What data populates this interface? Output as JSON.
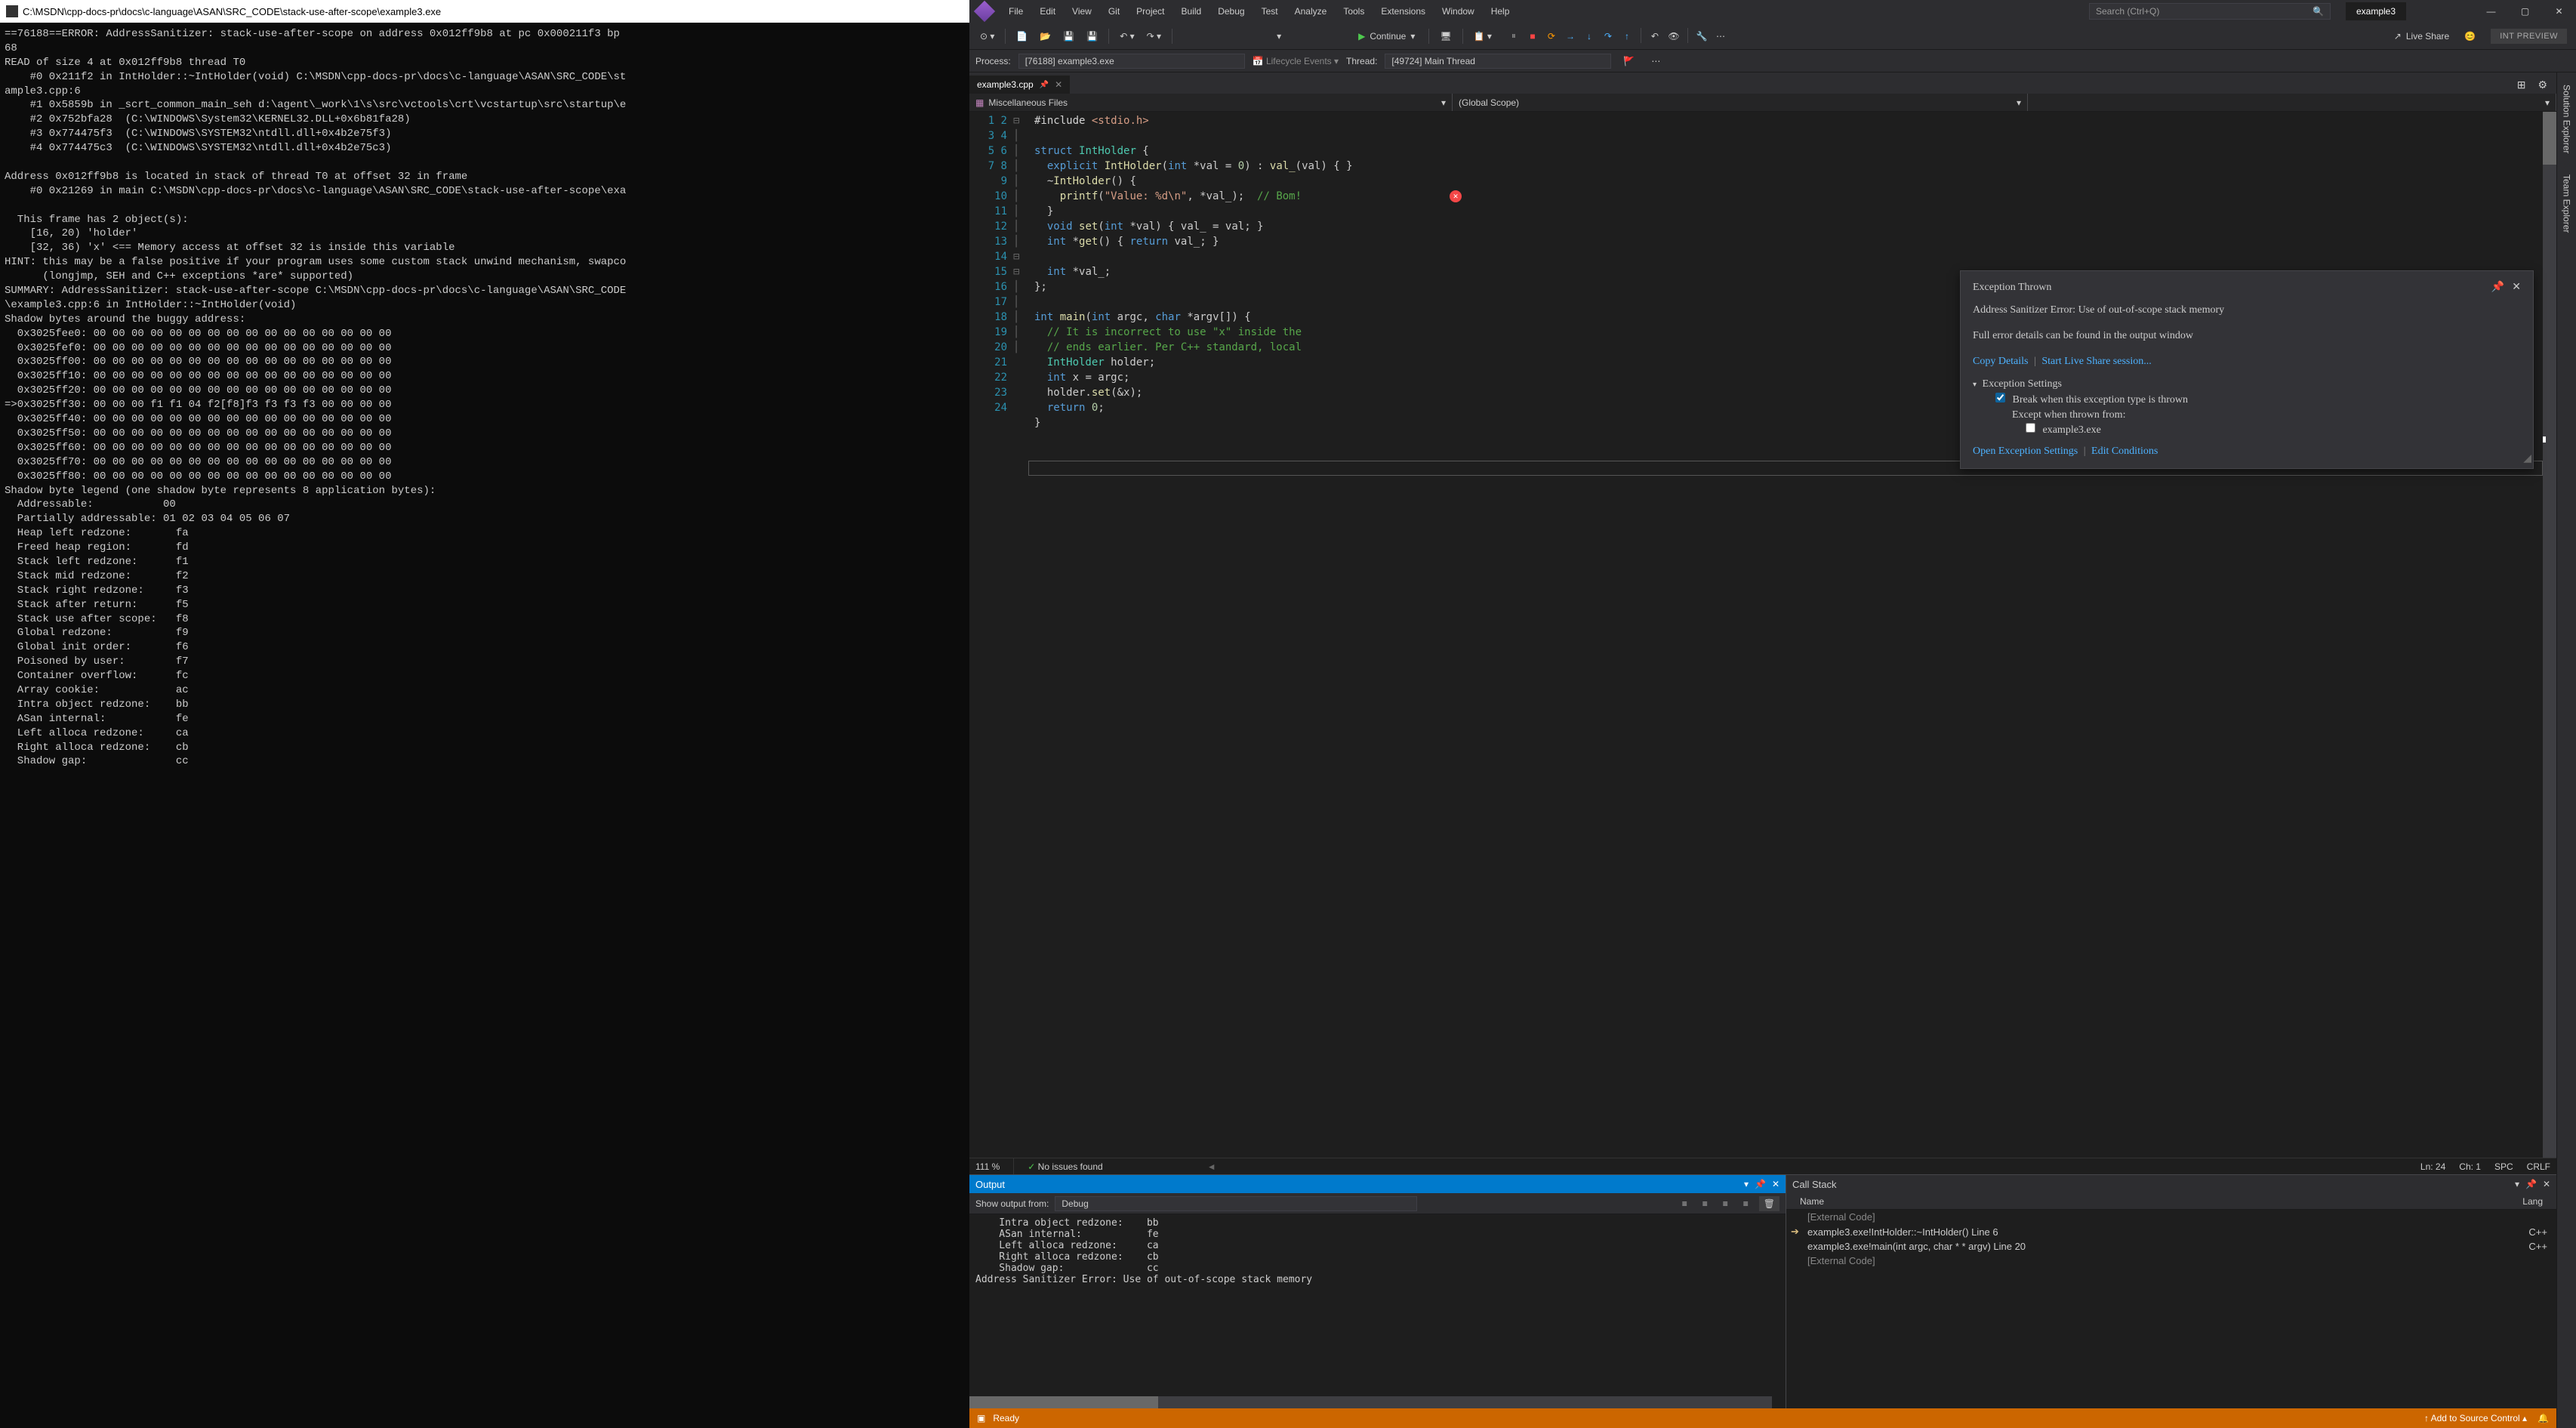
{
  "console": {
    "title_path": "C:\\MSDN\\cpp-docs-pr\\docs\\c-language\\ASAN\\SRC_CODE\\stack-use-after-scope\\example3.exe",
    "text": "==76188==ERROR: AddressSanitizer: stack-use-after-scope on address 0x012ff9b8 at pc 0x000211f3 bp\n68\nREAD of size 4 at 0x012ff9b8 thread T0\n    #0 0x211f2 in IntHolder::~IntHolder(void) C:\\MSDN\\cpp-docs-pr\\docs\\c-language\\ASAN\\SRC_CODE\\st\nample3.cpp:6\n    #1 0x5859b in _scrt_common_main_seh d:\\agent\\_work\\1\\s\\src\\vctools\\crt\\vcstartup\\src\\startup\\e\n    #2 0x752bfa28  (C:\\WINDOWS\\System32\\KERNEL32.DLL+0x6b81fa28)\n    #3 0x774475f3  (C:\\WINDOWS\\SYSTEM32\\ntdll.dll+0x4b2e75f3)\n    #4 0x774475c3  (C:\\WINDOWS\\SYSTEM32\\ntdll.dll+0x4b2e75c3)\n\nAddress 0x012ff9b8 is located in stack of thread T0 at offset 32 in frame\n    #0 0x21269 in main C:\\MSDN\\cpp-docs-pr\\docs\\c-language\\ASAN\\SRC_CODE\\stack-use-after-scope\\exa\n\n  This frame has 2 object(s):\n    [16, 20) 'holder'\n    [32, 36) 'x' <== Memory access at offset 32 is inside this variable\nHINT: this may be a false positive if your program uses some custom stack unwind mechanism, swapco\n      (longjmp, SEH and C++ exceptions *are* supported)\nSUMMARY: AddressSanitizer: stack-use-after-scope C:\\MSDN\\cpp-docs-pr\\docs\\c-language\\ASAN\\SRC_CODE\n\\example3.cpp:6 in IntHolder::~IntHolder(void)\nShadow bytes around the buggy address:\n  0x3025fee0: 00 00 00 00 00 00 00 00 00 00 00 00 00 00 00 00\n  0x3025fef0: 00 00 00 00 00 00 00 00 00 00 00 00 00 00 00 00\n  0x3025ff00: 00 00 00 00 00 00 00 00 00 00 00 00 00 00 00 00\n  0x3025ff10: 00 00 00 00 00 00 00 00 00 00 00 00 00 00 00 00\n  0x3025ff20: 00 00 00 00 00 00 00 00 00 00 00 00 00 00 00 00\n=>0x3025ff30: 00 00 00 f1 f1 04 f2[f8]f3 f3 f3 f3 00 00 00 00\n  0x3025ff40: 00 00 00 00 00 00 00 00 00 00 00 00 00 00 00 00\n  0x3025ff50: 00 00 00 00 00 00 00 00 00 00 00 00 00 00 00 00\n  0x3025ff60: 00 00 00 00 00 00 00 00 00 00 00 00 00 00 00 00\n  0x3025ff70: 00 00 00 00 00 00 00 00 00 00 00 00 00 00 00 00\n  0x3025ff80: 00 00 00 00 00 00 00 00 00 00 00 00 00 00 00 00\nShadow byte legend (one shadow byte represents 8 application bytes):\n  Addressable:           00\n  Partially addressable: 01 02 03 04 05 06 07\n  Heap left redzone:       fa\n  Freed heap region:       fd\n  Stack left redzone:      f1\n  Stack mid redzone:       f2\n  Stack right redzone:     f3\n  Stack after return:      f5\n  Stack use after scope:   f8\n  Global redzone:          f9\n  Global init order:       f6\n  Poisoned by user:        f7\n  Container overflow:      fc\n  Array cookie:            ac\n  Intra object redzone:    bb\n  ASan internal:           fe\n  Left alloca redzone:     ca\n  Right alloca redzone:    cb\n  Shadow gap:              cc"
  },
  "menu": [
    "File",
    "Edit",
    "View",
    "Git",
    "Project",
    "Build",
    "Debug",
    "Test",
    "Analyze",
    "Tools",
    "Extensions",
    "Window",
    "Help"
  ],
  "search_placeholder": "Search (Ctrl+Q)",
  "solution_name": "example3",
  "continue_label": "Continue",
  "live_share_label": "Live Share",
  "preview_badge": "INT PREVIEW",
  "process_bar": {
    "proc_label": "Process:",
    "proc_value": "[76188] example3.exe",
    "lifecycle": "Lifecycle Events",
    "thread_label": "Thread:",
    "thread_value": "[49724] Main Thread"
  },
  "side_tabs": [
    "Solution Explorer",
    "Team Explorer"
  ],
  "doc_tab": "example3.cpp",
  "nav_left": "Miscellaneous Files",
  "nav_right": "(Global Scope)",
  "code_lines": 24,
  "exception": {
    "title": "Exception Thrown",
    "message": "Address Sanitizer Error: Use of out-of-scope stack memory",
    "details_hint": "Full error details can be found in the output window",
    "copy": "Copy Details",
    "share": "Start Live Share session...",
    "settings_hdr": "Exception Settings",
    "break_when": "Break when this exception type is thrown",
    "except_from": "Except when thrown from:",
    "module": "example3.exe",
    "open_settings": "Open Exception Settings",
    "edit_cond": "Edit Conditions"
  },
  "status_editor": {
    "zoom": "111 %",
    "issues": "No issues found",
    "ln": "Ln: 24",
    "ch": "Ch: 1",
    "spc": "SPC",
    "crlf": "CRLF"
  },
  "output": {
    "title": "Output",
    "show_from": "Show output from:",
    "source": "Debug",
    "text": "    Intra object redzone:    bb\n    ASan internal:           fe\n    Left alloca redzone:     ca\n    Right alloca redzone:    cb\n    Shadow gap:              cc\nAddress Sanitizer Error: Use of out-of-scope stack memory"
  },
  "callstack": {
    "title": "Call Stack",
    "col_name": "Name",
    "col_lang": "Lang",
    "frames": [
      {
        "arrow": "",
        "name": "[External Code]",
        "lang": "",
        "ext": true
      },
      {
        "arrow": "➔",
        "name": "example3.exe!IntHolder::~IntHolder() Line 6",
        "lang": "C++"
      },
      {
        "arrow": "",
        "name": "example3.exe!main(int argc, char * * argv) Line 20",
        "lang": "C++"
      },
      {
        "arrow": "",
        "name": "[External Code]",
        "lang": "",
        "ext": true
      }
    ]
  },
  "status_bar": {
    "ready": "Ready",
    "source_ctrl": "Add to Source Control"
  }
}
